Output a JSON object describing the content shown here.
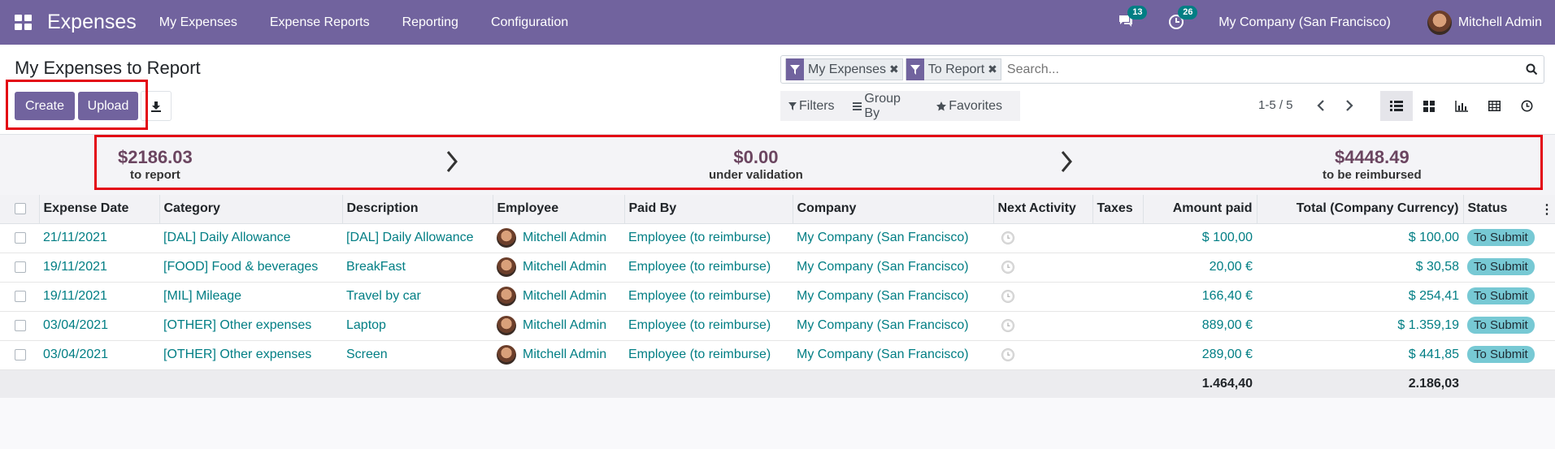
{
  "navbar": {
    "brand": "Expenses",
    "menu": [
      "My Expenses",
      "Expense Reports",
      "Reporting",
      "Configuration"
    ],
    "messages_count": "13",
    "activities_count": "26",
    "company": "My Company (San Francisco)",
    "user": "Mitchell Admin"
  },
  "control": {
    "title": "My Expenses to Report",
    "create_label": "Create",
    "upload_label": "Upload",
    "facets": [
      "My Expenses",
      "To Report"
    ],
    "search_placeholder": "Search...",
    "filters_label": "Filters",
    "groupby_label": "Group By",
    "favorites_label": "Favorites",
    "pager": "1-5 / 5"
  },
  "dashboard": {
    "to_report_amount": "$2186.03",
    "to_report_label": "to report",
    "validation_amount": "$0.00",
    "validation_label": "under validation",
    "reimbursed_amount": "$4448.49",
    "reimbursed_label": "to be reimbursed",
    "amount_color": "#6b4560"
  },
  "table": {
    "columns": [
      "Expense Date",
      "Category",
      "Description",
      "Employee",
      "Paid By",
      "Company",
      "Next Activity",
      "Taxes",
      "Amount paid",
      "Total (Company Currency)",
      "Status"
    ],
    "rows": [
      {
        "date": "21/11/2021",
        "category": "[DAL] Daily Allowance",
        "description": "[DAL] Daily Allowance",
        "employee": "Mitchell Admin",
        "paid_by": "Employee (to reimburse)",
        "company": "My Company (San Francisco)",
        "amount": "$ 100,00",
        "total": "$ 100,00",
        "status": "To Submit"
      },
      {
        "date": "19/11/2021",
        "category": "[FOOD] Food & beverages",
        "description": "BreakFast",
        "employee": "Mitchell Admin",
        "paid_by": "Employee (to reimburse)",
        "company": "My Company (San Francisco)",
        "amount": "20,00 €",
        "total": "$ 30,58",
        "status": "To Submit"
      },
      {
        "date": "19/11/2021",
        "category": "[MIL] Mileage",
        "description": "Travel by car",
        "employee": "Mitchell Admin",
        "paid_by": "Employee (to reimburse)",
        "company": "My Company (San Francisco)",
        "amount": "166,40 €",
        "total": "$ 254,41",
        "status": "To Submit"
      },
      {
        "date": "03/04/2021",
        "category": "[OTHER] Other expenses",
        "description": "Laptop",
        "employee": "Mitchell Admin",
        "paid_by": "Employee (to reimburse)",
        "company": "My Company (San Francisco)",
        "amount": "889,00 €",
        "total": "$ 1.359,19",
        "status": "To Submit"
      },
      {
        "date": "03/04/2021",
        "category": "[OTHER] Other expenses",
        "description": "Screen",
        "employee": "Mitchell Admin",
        "paid_by": "Employee (to reimburse)",
        "company": "My Company (San Francisco)",
        "amount": "289,00 €",
        "total": "$ 441,85",
        "status": "To Submit"
      }
    ],
    "footer": {
      "amount_total": "1.464,40",
      "total_total": "2.186,03"
    }
  },
  "colors": {
    "primary": "#71639e",
    "link": "#017e84",
    "highlight": "#e30613",
    "status_badge": "#77c9d4"
  }
}
